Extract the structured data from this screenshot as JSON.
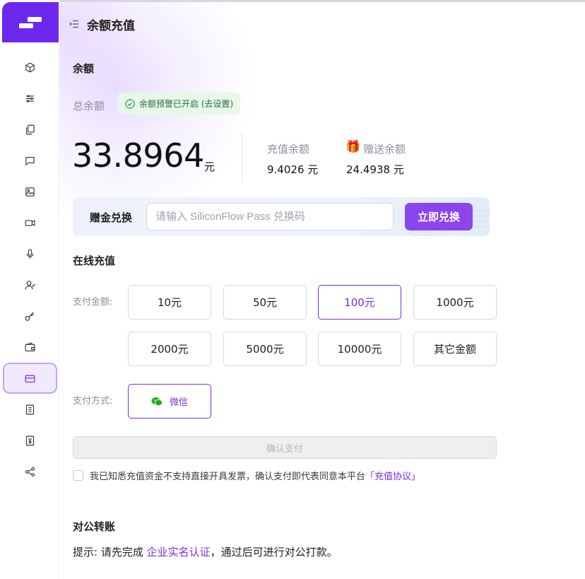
{
  "header": {
    "title": "余额充值"
  },
  "sidebar": {
    "items": [
      {
        "name": "models",
        "icon": "cube-icon"
      },
      {
        "name": "playground",
        "icon": "sliders-icon"
      },
      {
        "name": "batch",
        "icon": "copy-files-icon"
      },
      {
        "name": "chat",
        "icon": "chat-bubble-icon"
      },
      {
        "name": "image",
        "icon": "image-icon"
      },
      {
        "name": "video",
        "icon": "video-icon"
      },
      {
        "name": "audio",
        "icon": "microphone-icon"
      },
      {
        "name": "user",
        "icon": "user-check-icon"
      },
      {
        "name": "api-keys",
        "icon": "key-icon"
      },
      {
        "name": "wallet",
        "icon": "wallet-icon"
      },
      {
        "name": "recharge",
        "icon": "credit-card-icon",
        "active": true
      },
      {
        "name": "bills",
        "icon": "document-icon"
      },
      {
        "name": "expenses",
        "icon": "yen-icon"
      },
      {
        "name": "share",
        "icon": "share-icon"
      }
    ]
  },
  "balance": {
    "section_title": "余额",
    "total_label": "总余额",
    "warning_badge": "余额预警已开启 (去设置)",
    "total_amount": "33.8964",
    "unit": "元",
    "recharge_label": "充值余额",
    "recharge_value": "9.4026 元",
    "gift_label": "赠送余额",
    "gift_value": "24.4938 元",
    "gift_emoji": "🎁"
  },
  "redeem": {
    "label": "赠金兑换",
    "placeholder": "请输入 SiliconFlow Pass 兑换码",
    "button": "立即兑换"
  },
  "online": {
    "section_title": "在线充值",
    "amount_label": "支付金额:",
    "amounts": [
      "10元",
      "50元",
      "100元",
      "1000元",
      "2000元",
      "5000元",
      "10000元",
      "其它金额"
    ],
    "selected_amount": "100元",
    "method_label": "支付方式:",
    "method": "微信",
    "confirm_button": "确认支付",
    "agreement_text": "我已知悉充值资金不支持直接开具发票，确认支付即代表同意本平台",
    "agreement_link": "「充值协议」"
  },
  "transfer": {
    "section_title": "对公转账",
    "hint_prefix": "提示: 请先完成 ",
    "hint_link": "企业实名认证",
    "hint_suffix": "，通过后可进行对公打款。"
  },
  "colors": {
    "brand": "#6d28f0",
    "accent": "#7b2fe0",
    "button": "#8b45ee",
    "wechat_green": "#1aad19",
    "badge_bg": "#e7f7e9"
  }
}
